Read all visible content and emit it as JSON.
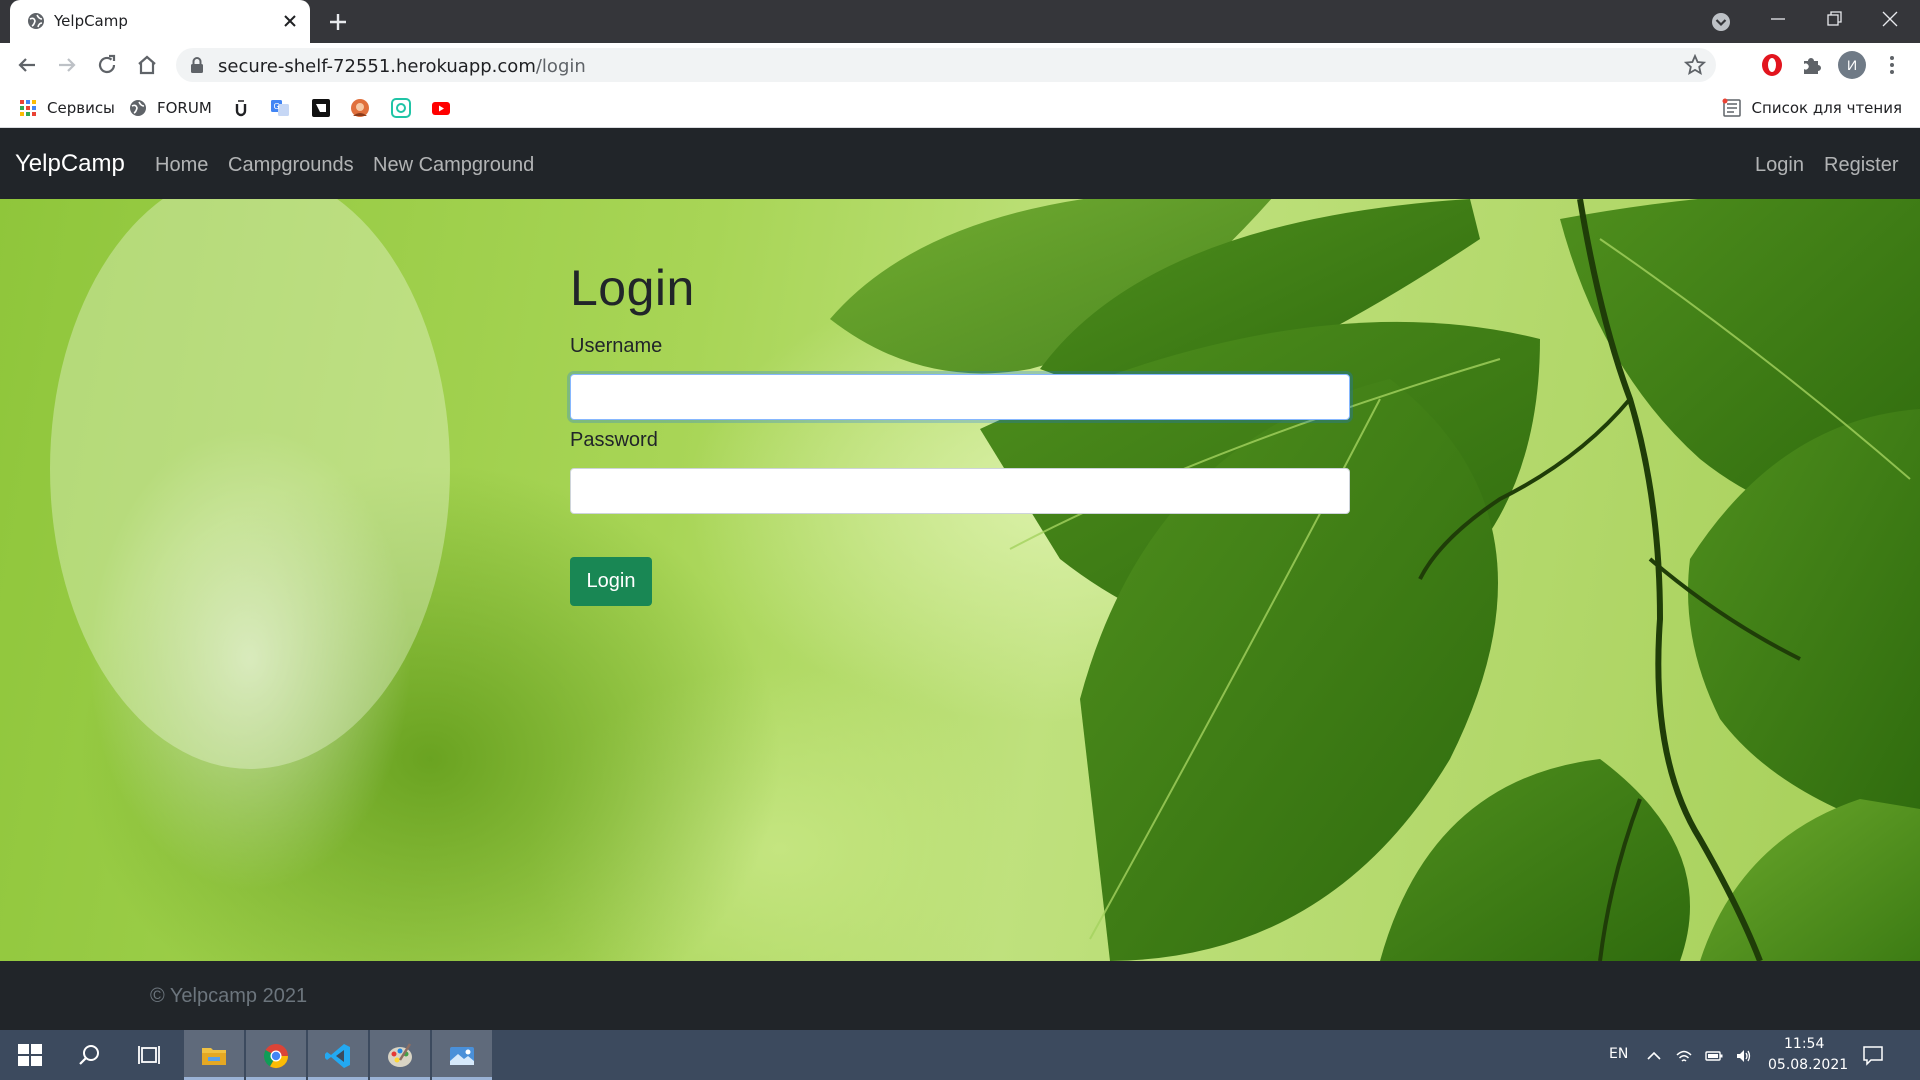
{
  "browser": {
    "tab_title": "YelpCamp",
    "url_host": "secure-shelf-72551.herokuapp.com",
    "url_path": "/login",
    "profile_initial": "И"
  },
  "bookmarks": {
    "apps_label": "Сервисы",
    "forum_label": "FORUM",
    "reading_list_label": "Список для чтения"
  },
  "site": {
    "brand": "YelpCamp",
    "nav_left": [
      "Home",
      "Campgrounds",
      "New Campground"
    ],
    "nav_right": [
      "Login",
      "Register"
    ]
  },
  "login": {
    "title": "Login",
    "username_label": "Username",
    "username_value": "",
    "password_label": "Password",
    "password_value": "",
    "submit_label": "Login"
  },
  "footer": {
    "copyright": "© Yelpcamp 2021"
  },
  "taskbar": {
    "language": "EN",
    "time": "11:54",
    "date": "05.08.2021"
  },
  "colors": {
    "navbar_bg": "#212529",
    "success_button": "#198754",
    "taskbar_bg": "#3c4a5e"
  }
}
